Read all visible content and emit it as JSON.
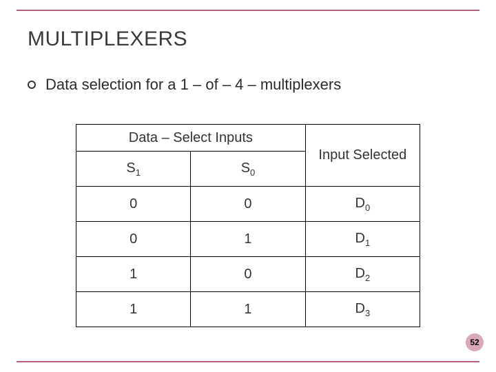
{
  "title": "MULTIPLEXERS",
  "bullet": "Data selection for a 1 – of – 4 – multiplexers",
  "table": {
    "header_left": "Data – Select Inputs",
    "header_right": "Input Selected",
    "sub_headers": {
      "s1": "S",
      "s1_sub": "1",
      "s0": "S",
      "s0_sub": "0"
    },
    "rows": [
      {
        "s1": "0",
        "s0": "0",
        "out": "D",
        "out_sub": "0"
      },
      {
        "s1": "0",
        "s0": "1",
        "out": "D",
        "out_sub": "1"
      },
      {
        "s1": "1",
        "s0": "0",
        "out": "D",
        "out_sub": "2"
      },
      {
        "s1": "1",
        "s0": "1",
        "out": "D",
        "out_sub": "3"
      }
    ]
  },
  "page_number": "52",
  "chart_data": {
    "type": "table",
    "title": "Data selection for a 1-of-4 multiplexer",
    "columns": [
      "S1",
      "S0",
      "Input Selected"
    ],
    "rows": [
      [
        "0",
        "0",
        "D0"
      ],
      [
        "0",
        "1",
        "D1"
      ],
      [
        "1",
        "0",
        "D2"
      ],
      [
        "1",
        "1",
        "D3"
      ]
    ]
  }
}
